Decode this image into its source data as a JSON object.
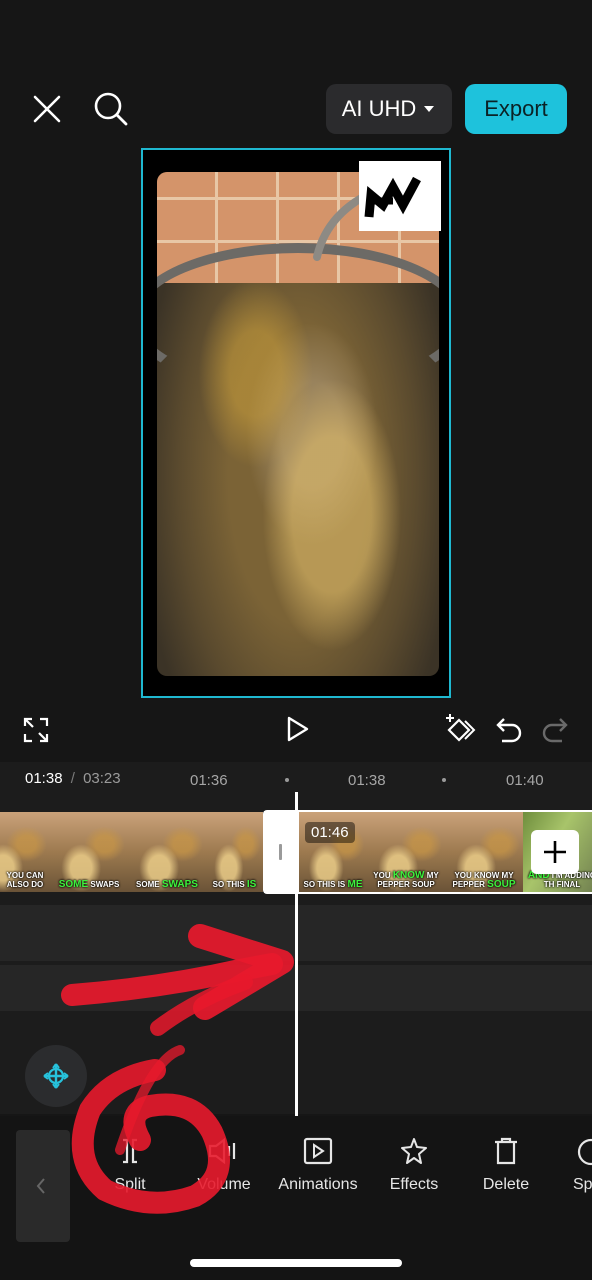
{
  "header": {
    "close_icon": "close-icon",
    "search_icon": "search-icon",
    "resolution_label": "AI UHD",
    "export_label": "Export"
  },
  "colors": {
    "accent": "#1ec2dc",
    "background": "#161616",
    "caption_highlight": "#3cf23c",
    "annotation_red": "#e8192c"
  },
  "playback": {
    "fullscreen_icon": "fullscreen-icon",
    "play_icon": "play-icon",
    "keyframe_icon": "keyframe-icon",
    "undo_icon": "undo-icon",
    "redo_icon": "redo-icon"
  },
  "ruler": {
    "current_time": "01:38",
    "separator": "/",
    "total_time": "03:23",
    "ticks": [
      "01:36",
      "01:38",
      "01:40"
    ]
  },
  "timeline": {
    "selected_clip_duration": "01:46",
    "left_clip_captions": [
      {
        "before": "YOU CAN ALSO DO",
        "highlight": "",
        "after": ""
      },
      {
        "before": "",
        "highlight": "SOME",
        "after": " SWAPS"
      },
      {
        "before": "SOME ",
        "highlight": "SWAPS",
        "after": ""
      },
      {
        "before": "SO THIS ",
        "highlight": "IS",
        "after": ""
      }
    ],
    "right_clip_captions": [
      {
        "before": "SO THIS IS ",
        "highlight": "ME",
        "after": ""
      },
      {
        "before": "YOU ",
        "highlight": "KNOW",
        "after": " MY PEPPER SOUP"
      },
      {
        "before": "YOU KNOW MY PEPPER ",
        "highlight": "SOUP",
        "after": ""
      },
      {
        "before": "",
        "highlight": "AND",
        "after": " I'M ADDING TH FINAL"
      }
    ],
    "add_clip_icon": "plus-icon",
    "keyframe_float_icon": "move-keyframe-icon"
  },
  "toolbar": {
    "items": [
      {
        "label": "Split",
        "icon": "split-icon"
      },
      {
        "label": "Volume",
        "icon": "volume-icon"
      },
      {
        "label": "Animations",
        "icon": "animations-icon"
      },
      {
        "label": "Effects",
        "icon": "effects-icon"
      },
      {
        "label": "Delete",
        "icon": "delete-icon"
      },
      {
        "label": "Sp",
        "icon": "speed-icon"
      }
    ]
  }
}
